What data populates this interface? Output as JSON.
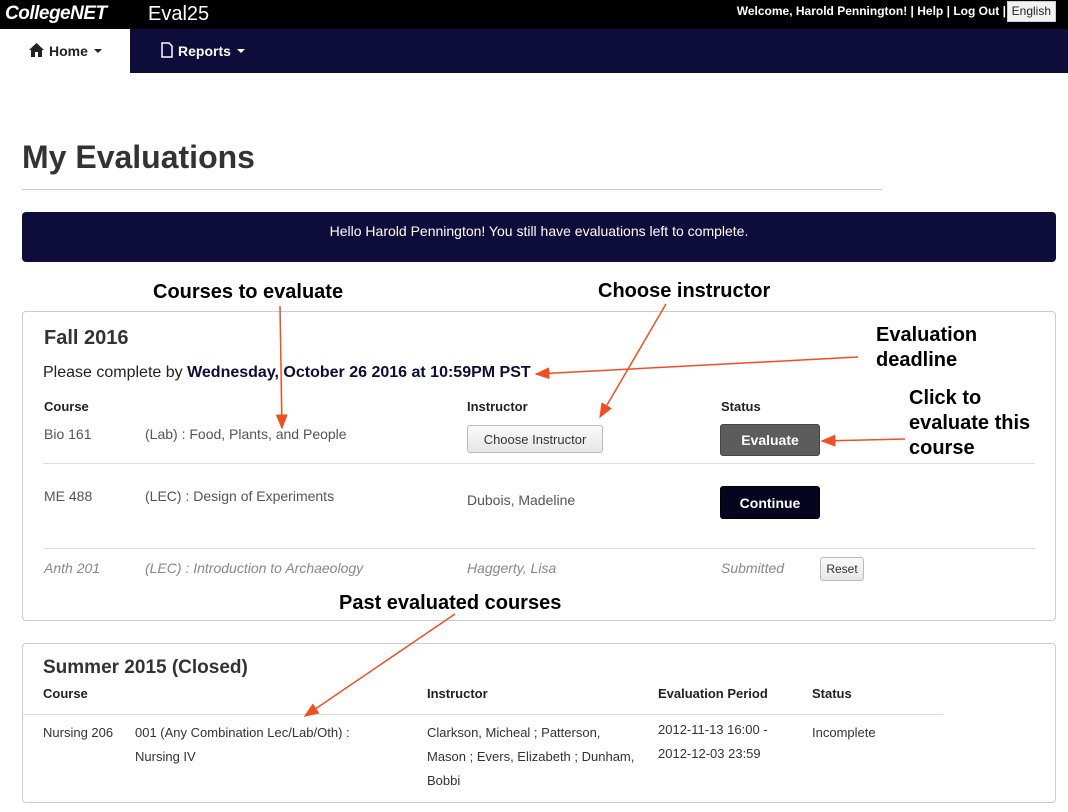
{
  "topbar": {
    "logo": "CollegeNET",
    "app_name": "Eval25",
    "welcome": "Welcome, Harold Pennington!",
    "sep": "|",
    "help": "Help",
    "logout": "Log Out",
    "language": "English"
  },
  "nav": {
    "home": "Home",
    "reports": "Reports"
  },
  "page": {
    "title": "My Evaluations",
    "banner": "Hello Harold Pennington! You still have evaluations left to complete."
  },
  "fall": {
    "term": "Fall 2016",
    "deadline_prefix": "Please complete by",
    "deadline": "Wednesday, October 26 2016 at 10:59PM PST",
    "headers": {
      "course": "Course",
      "instructor": "Instructor",
      "status": "Status"
    },
    "rows": [
      {
        "code": "Bio 161",
        "title": "(Lab) : Food, Plants, and People",
        "instructor_button": "Choose Instructor",
        "status_button": "Evaluate"
      },
      {
        "code": "ME 488",
        "title": "(LEC) : Design of Experiments",
        "instructor": "Dubois, Madeline",
        "status_button": "Continue"
      },
      {
        "code": "Anth 201",
        "title": "(LEC) : Introduction to Archaeology",
        "instructor": "Haggerty, Lisa",
        "status": "Submitted",
        "reset_button": "Reset"
      }
    ]
  },
  "summer": {
    "term": "Summer 2015 (Closed)",
    "headers": {
      "course": "Course",
      "instructor": "Instructor",
      "period": "Evaluation Period",
      "status": "Status"
    },
    "row": {
      "code": "Nursing 206",
      "title_line1": "001 (Any Combination Lec/Lab/Oth) :",
      "title_line2": "Nursing IV",
      "instr_line1": "Clarkson, Micheal ; Patterson,",
      "instr_line2": "Mason ; Evers, Elizabeth ; Dunham,",
      "instr_line3": "Bobbi",
      "period_line1": "2012-11-13 16:00 -",
      "period_line2": "2012-12-03 23:59",
      "status": "Incomplete"
    }
  },
  "annotations": {
    "courses_to_evaluate": "Courses to evaluate",
    "choose_instructor": "Choose instructor",
    "deadline_line1": "Evaluation",
    "deadline_line2": "deadline",
    "click_line1": "Click to",
    "click_line2": "evaluate this",
    "click_line3": "course",
    "past_courses": "Past evaluated courses"
  },
  "colors": {
    "navy": "#0d0c3b",
    "arrow": "#f04e23"
  },
  "icons": {
    "home": "home-icon",
    "reports": "document-icon"
  }
}
